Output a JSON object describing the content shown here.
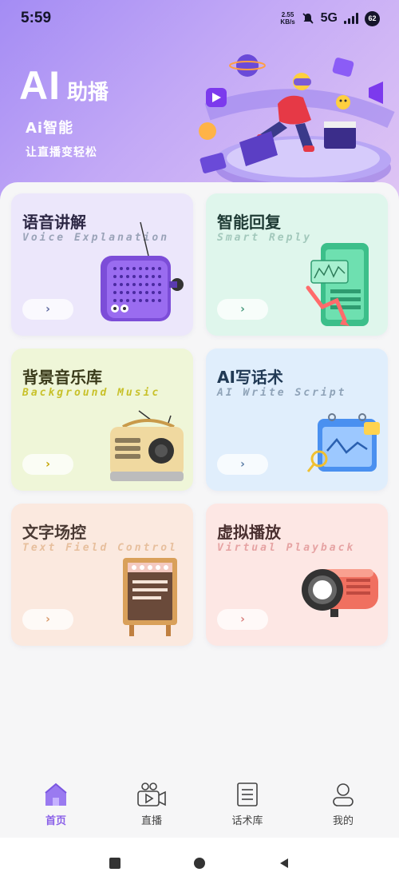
{
  "status": {
    "time": "5:59",
    "net_speed_value": "2.55",
    "net_speed_unit": "KB/s",
    "network": "5G",
    "battery": "62"
  },
  "header": {
    "brand_ai": "AI",
    "brand_cn": "助播",
    "subtitle": "Ai智能",
    "tagline": "让直播变轻松"
  },
  "cards": [
    {
      "title": "语音讲解",
      "subtitle": "Voice Explanation",
      "button": "›",
      "bg": "#ece7fb",
      "title_color": "#2c2744",
      "sub_color": "#9aa3b8",
      "arrow_color": "#5f6aa0"
    },
    {
      "title": "智能回复",
      "subtitle": "Smart Reply",
      "button": "›",
      "bg": "#dff6ec",
      "title_color": "#1f3b35",
      "sub_color": "#a2c8bb",
      "arrow_color": "#4a9a7e"
    },
    {
      "title": "背景音乐库",
      "subtitle": "Background Music",
      "button": "›",
      "bg": "#eff6d8",
      "title_color": "#3a3a1a",
      "sub_color": "#c8c12a",
      "arrow_color": "#c4a400"
    },
    {
      "title": "AI写话术",
      "subtitle": "AI Write Script",
      "button": "›",
      "bg": "#e0eefc",
      "title_color": "#213a55",
      "sub_color": "#8fa3b8",
      "arrow_color": "#5a7ca6"
    },
    {
      "title": "文字场控",
      "subtitle": "Text Field Control",
      "button": "›",
      "bg": "#fbe9df",
      "title_color": "#4a3a34",
      "sub_color": "#e7bf9d",
      "arrow_color": "#d89a6c"
    },
    {
      "title": "虚拟播放",
      "subtitle": "Virtual Playback",
      "button": "›",
      "bg": "#fde7e4",
      "title_color": "#4a3030",
      "sub_color": "#e6a3a3",
      "arrow_color": "#d9807e"
    }
  ],
  "tabs": [
    {
      "label": "首页",
      "icon": "home-icon",
      "active": true
    },
    {
      "label": "直播",
      "icon": "camera-icon",
      "active": false
    },
    {
      "label": "话术库",
      "icon": "document-icon",
      "active": false
    },
    {
      "label": "我的",
      "icon": "user-icon",
      "active": false
    }
  ],
  "colors": {
    "accent": "#8a60e8",
    "hero_start": "#a48cf4",
    "hero_end": "#e0c6f4"
  }
}
